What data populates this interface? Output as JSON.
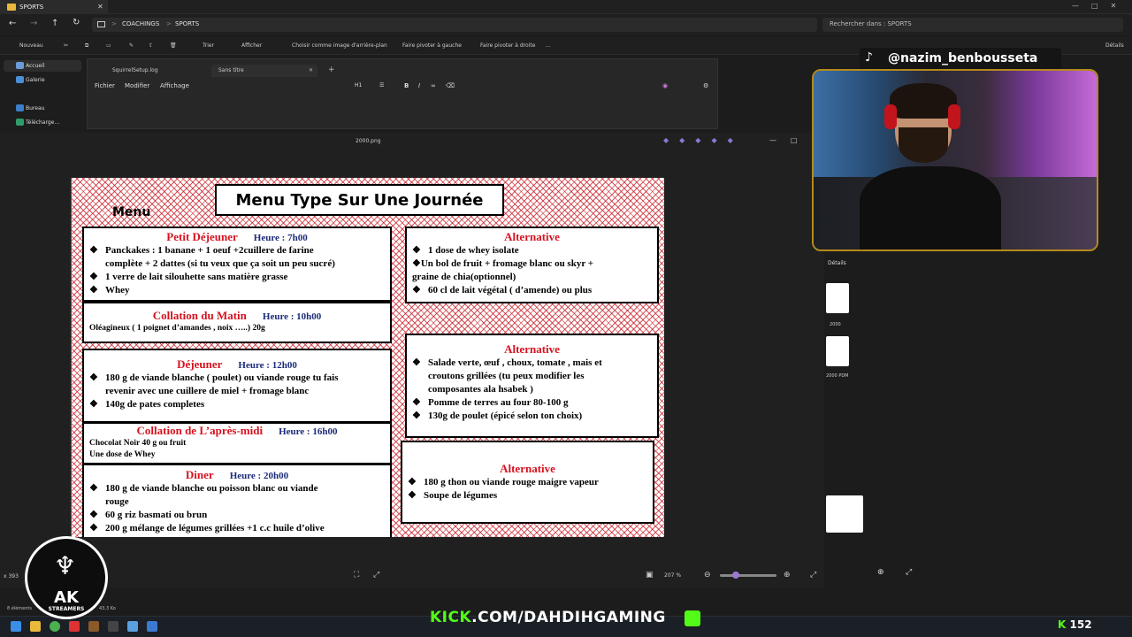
{
  "explorer": {
    "tab_title": "SPORTS",
    "breadcrumb": [
      "COACHINGS",
      "SPORTS"
    ],
    "breadcrumb_sep": ">",
    "search_placeholder": "Rechercher dans : SPORTS",
    "commands": [
      "Nouveau",
      "Trier",
      "Afficher",
      "Choisir comme image d'arrière-plan",
      "Faire pivoter à gauche",
      "Faire pivoter à droite",
      "...",
      "Détails"
    ],
    "nav": [
      "Accueil",
      "Galerie",
      "Bureau",
      "Télécharge…"
    ],
    "status_left": "8 éléments",
    "status_size": "43,3 Ko",
    "details_label": "Détails",
    "files": [
      "2000",
      "2000 PDM"
    ]
  },
  "notepad": {
    "tabs": [
      "SquirrelSetup.log",
      "Sans titre"
    ],
    "menu": [
      "Fichier",
      "Modifier",
      "Affichage"
    ],
    "heading_btn": "H1"
  },
  "viewer": {
    "filename": "2000.png",
    "zoom": "207 %",
    "coords": "x 393"
  },
  "menu": {
    "title": "Menu Type Sur Une Journée",
    "menu_word": "Menu",
    "petit_dej": {
      "title": "Petit Déjeuner",
      "hour": "Heure : 7h00",
      "lines": [
        "Panckakes : 1 banane + 1 oeuf +2cuillere de farine",
        "complète + 2 dattes (si tu veux que ça soit un peu sucré)",
        "1 verre de lait silouhette  sans matière grasse",
        "Whey"
      ]
    },
    "collation_matin": {
      "title": "Collation du Matin",
      "hour": "Heure : 10h00",
      "line": "Oléagineux ( 1 poignet d’amandes , noix …..) 20g"
    },
    "dejeuner": {
      "title": "Déjeuner",
      "hour": "Heure : 12h00",
      "lines": [
        "180 g de viande blanche ( poulet) ou viande rouge tu fais",
        "revenir avec une cuillere de miel + fromage blanc",
        "140g de pates completes"
      ]
    },
    "collation_aprem": {
      "title": "Collation de L’après-midi",
      "hour": "Heure : 16h00",
      "lines": [
        "Chocolat Noir 40 g ou fruit",
        "Une dose de Whey"
      ]
    },
    "diner": {
      "title": "Diner",
      "hour": "Heure : 20h00",
      "lines": [
        "180 g de viande blanche  ou poisson blanc ou viande",
        "rouge",
        "60 g riz basmati ou brun",
        "200 g mélange de légumes grillées  +1 c.c huile d’olive"
      ]
    },
    "alt1": {
      "title": "Alternative",
      "lines": [
        "1 dose de whey isolate",
        "❖Un bol de  fruit + fromage blanc ou skyr +",
        "graine de chia(optionnel)",
        "60 cl de lait végétal ( d’amende)  ou plus"
      ]
    },
    "alt2": {
      "title": "Alternative",
      "lines": [
        "Salade verte, œuf , choux, tomate , mais et",
        "croutons grillées (tu peux modifier les",
        "composantes ala hsabek )",
        "Pomme de terres au four 80-100 g",
        "130g de poulet (épicé selon ton choix)"
      ]
    },
    "alt3": {
      "title": "Alternative",
      "lines": [
        "180 g thon ou viande rouge maigre vapeur",
        "Soupe de légumes"
      ]
    }
  },
  "overlay": {
    "tiktok_handle": "@nazim_benbousseta",
    "kick_prefix": "KICK",
    "kick_text": ".COM/DAHDIHGAMING",
    "logo_text": "AK",
    "logo_sub": "STREAMERS",
    "viewer_count": "152"
  },
  "colors": {
    "accent_red": "#d7121f",
    "hour_blue": "#1c2c7a",
    "kick_green": "#53fc18"
  }
}
